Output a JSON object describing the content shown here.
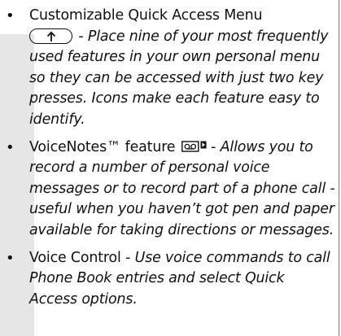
{
  "features": [
    {
      "title": "Customizable Quick Access Menu",
      "key_icon": "up-arrow-key-icon",
      "separator": " - ",
      "description": "Place nine of your most frequently used features in your own personal menu so they can be accessed with just two key presses. Icons make each feature easy to identify."
    },
    {
      "title": "VoiceNotes™ feature",
      "icon": "voicenotes-icon",
      "separator": " - ",
      "description": "Allows you to record a number of personal voice messages or to record part of a phone call - useful when you haven’t got pen and paper available for taking directions or messages."
    },
    {
      "title": "Voice Control",
      "separator": " - ",
      "description": "Use voice commands to call Phone Book entries and select Quick Access options."
    }
  ]
}
